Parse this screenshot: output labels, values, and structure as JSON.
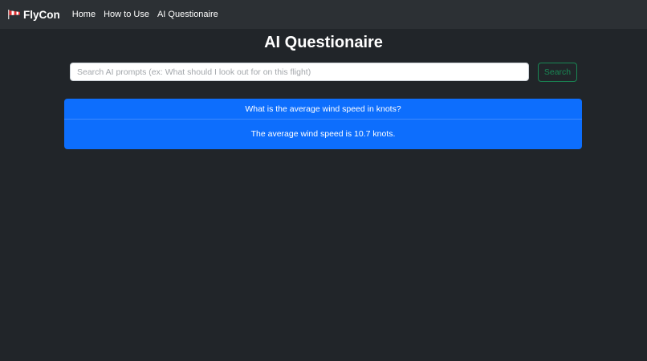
{
  "navbar": {
    "brand_icon": "windsock-icon",
    "brand_name": "FlyCon",
    "links": [
      {
        "label": "Home"
      },
      {
        "label": "How to Use"
      },
      {
        "label": "AI Questionaire"
      }
    ]
  },
  "page": {
    "title": "AI Questionaire"
  },
  "search": {
    "value": "",
    "placeholder": "Search AI prompts (ex: What should I look out for on this flight)",
    "button_label": "Search"
  },
  "qa": {
    "question": "What is the average wind speed in knots?",
    "answer": "The average wind speed is 10.7 knots."
  },
  "colors": {
    "background": "#212529",
    "navbar": "#2c3034",
    "card": "#0d6efd",
    "search_button": "#198754"
  }
}
